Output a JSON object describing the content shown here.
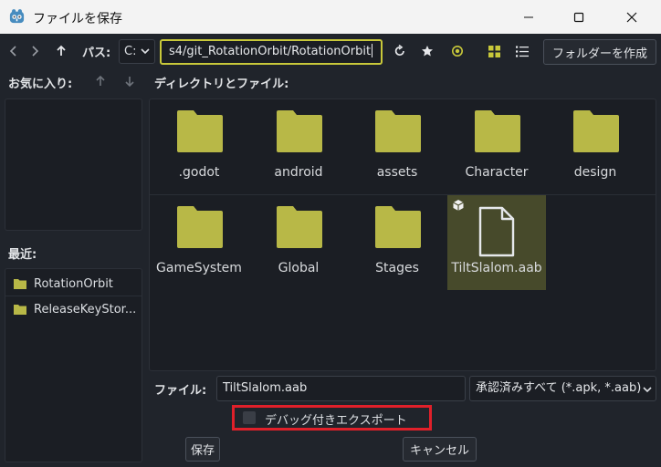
{
  "window": {
    "title": "ファイルを保存"
  },
  "toolbar": {
    "path_label": "パス:",
    "drive": "C:",
    "path_value": "s4/git_RotationOrbit/RotationOrbit",
    "create_folder_label": "フォルダーを作成"
  },
  "favorites": {
    "label": "お気に入り:"
  },
  "recent": {
    "label": "最近:",
    "items": [
      {
        "label": "RotationOrbit"
      },
      {
        "label": "ReleaseKeyStor..."
      }
    ]
  },
  "files": {
    "label": "ディレクトリとファイル:",
    "items": [
      {
        "label": ".godot",
        "type": "folder"
      },
      {
        "label": "android",
        "type": "folder"
      },
      {
        "label": "assets",
        "type": "folder"
      },
      {
        "label": "Character",
        "type": "folder"
      },
      {
        "label": "design",
        "type": "folder"
      },
      {
        "label": "GameSystem",
        "type": "folder"
      },
      {
        "label": "Global",
        "type": "folder"
      },
      {
        "label": "Stages",
        "type": "folder"
      },
      {
        "label": "TiltSlalom.aab",
        "type": "file",
        "selected": true
      }
    ]
  },
  "footer": {
    "file_label": "ファイル:",
    "file_value": "TiltSlalom.aab",
    "filter_value": "承認済みすべて (*.apk, *.aab)",
    "debug_export_label": "デバッグ付きエクスポート",
    "debug_export_checked": false,
    "save_label": "保存",
    "cancel_label": "キャンセル"
  },
  "colors": {
    "accent_folder": "#b8b847",
    "highlight_red": "#e0202a",
    "background": "#20242b",
    "panel": "#1b1e24",
    "selected_tile": "#474a2b"
  }
}
